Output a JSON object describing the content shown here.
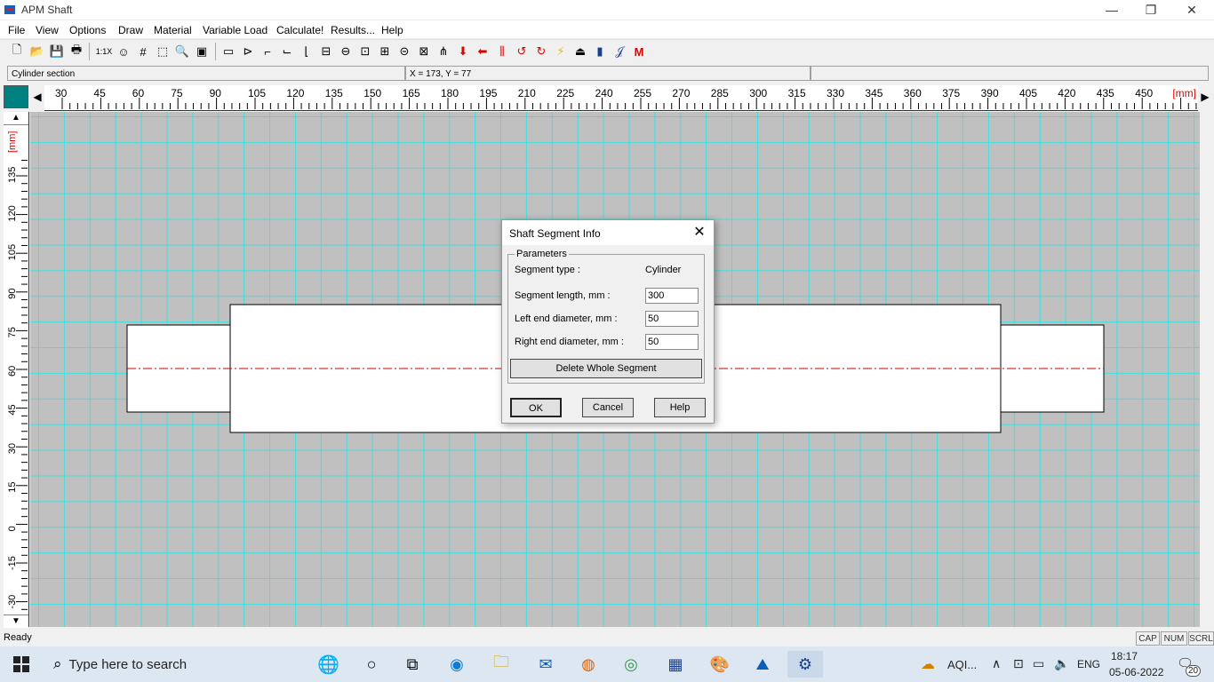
{
  "window": {
    "title": "APM Shaft",
    "minimize_icon": "—",
    "maximize_icon": "❐",
    "close_icon": "✕"
  },
  "menu": [
    "File",
    "View",
    "Options",
    "Draw",
    "Material",
    "Variable Load",
    "Calculate!",
    "Results...",
    "Help"
  ],
  "toolbar": {
    "zoom_label": "1:1X"
  },
  "info": {
    "section": "Cylinder section",
    "coords": "X = 173, Y = 77"
  },
  "ruler": {
    "h_ticks": [
      "30",
      "45",
      "60",
      "75",
      "90",
      "105",
      "120",
      "135",
      "150",
      "165",
      "180",
      "195",
      "210",
      "225",
      "240",
      "255",
      "270",
      "285",
      "300",
      "315",
      "330",
      "345",
      "360",
      "375",
      "390",
      "405",
      "420",
      "435",
      "450"
    ],
    "units": "[mm]",
    "v_ticks": [
      "135",
      "120",
      "105",
      "90",
      "75",
      "60",
      "45",
      "30",
      "15",
      "0",
      "-15",
      "-30"
    ],
    "v_units": "[mm]"
  },
  "status": {
    "text": "Ready",
    "cap": "CAP",
    "num": "NUM",
    "scrl": "SCRL"
  },
  "dialog": {
    "title": "Shaft Segment Info",
    "group_label": "Parameters",
    "segment_type_label": "Segment type :",
    "segment_type_value": "Cylinder",
    "length_label": "Segment length, mm :",
    "length_value": "300",
    "left_diameter_label": "Left end diameter, mm :",
    "left_diameter_value": "50",
    "right_diameter_label": "Right end diameter, mm :",
    "right_diameter_value": "50",
    "delete_button": "Delete Whole Segment",
    "ok_button": "OK",
    "cancel_button": "Cancel",
    "help_button": "Help"
  },
  "taskbar": {
    "search_placeholder": "Type here to search",
    "weather": "AQI...",
    "language": "ENG",
    "time": "18:17",
    "date": "05-06-2022",
    "notifications": "20"
  },
  "colors": {
    "grid": "#40e0e0",
    "canvas": "#c0c0c0",
    "centerline": "#cc0000",
    "ruler_corner": "#008080"
  }
}
